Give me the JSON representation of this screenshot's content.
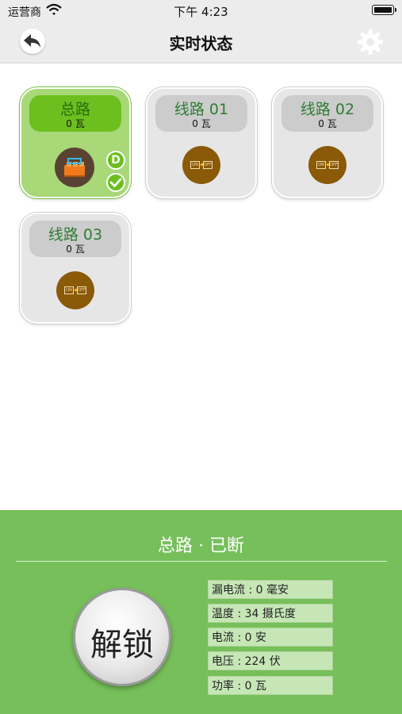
{
  "status_bar": {
    "carrier": "运营商",
    "time": "下午 4:23"
  },
  "nav": {
    "title": "实时状态",
    "back_icon": "back-arrow-icon",
    "settings_icon": "gear-icon"
  },
  "colors": {
    "accent": "#6cbf1f",
    "panel": "#76bf5a",
    "switch": "#8a5a09"
  },
  "circuits": [
    {
      "name": "总路",
      "power": "0 瓦",
      "active": true,
      "badge": "D"
    },
    {
      "name": "线路 01",
      "power": "0 瓦",
      "active": false,
      "on": "ON",
      "off": "OFF"
    },
    {
      "name": "线路 02",
      "power": "0 瓦",
      "active": false,
      "on": "ON",
      "off": "OFF"
    },
    {
      "name": "线路 03",
      "power": "0 瓦",
      "active": false,
      "on": "ON",
      "off": "OFF"
    }
  ],
  "panel": {
    "title": "总路 · 已断",
    "unlock_label": "解锁",
    "info": [
      "漏电流 : 0 毫安",
      "温度 : 34 摄氏度",
      "电流 : 0 安",
      "电压 : 224 伏",
      "功率 : 0 瓦"
    ]
  }
}
